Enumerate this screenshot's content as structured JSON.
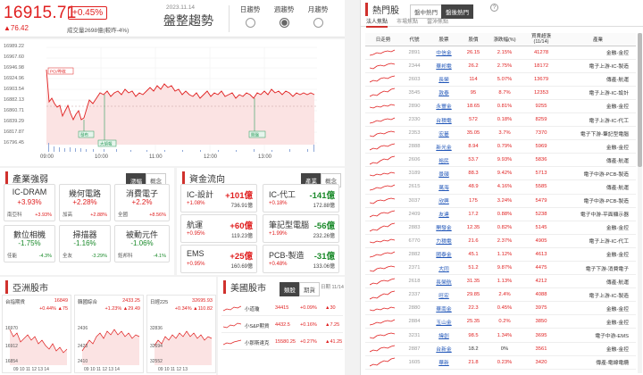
{
  "index": {
    "value": "16915.71",
    "pct": "+0.45%",
    "change": "▲76.42",
    "volume": "成交量2698億(較昨-4%)",
    "date": "2023.11.14",
    "trend": "盤整趨勢"
  },
  "trend_options": [
    {
      "label": "日趨勢",
      "selected": false
    },
    {
      "label": "週趨勢",
      "selected": true
    },
    {
      "label": "月趨勢",
      "selected": false
    }
  ],
  "chart": {
    "y_ticks": [
      "16989.22",
      "16967.60",
      "16946.98",
      "16924.96",
      "16903.54",
      "16882.13",
      "16860.71",
      "16839.29",
      "16817.87",
      "16796.45"
    ],
    "x_ticks": [
      "09:00",
      "10:00",
      "11:00",
      "12:00",
      "13:00"
    ],
    "prev_close_label": "PCI/昨收",
    "markers": [
      "發布",
      "大偵報",
      "開盤"
    ],
    "colors": {
      "line": "#e02020",
      "fill": "#fbe3e3",
      "volume": "#8fa8d8"
    }
  },
  "sectors": {
    "title": "產業強弱",
    "tabs": [
      "漲幅",
      "概念"
    ],
    "cards": [
      {
        "name": "IC-DRAM",
        "pct": "+3.93%",
        "l1": "南亞科",
        "v1": "+3.93%",
        "l2": "",
        "v2": "",
        "dir": "up"
      },
      {
        "name": "幾何電路",
        "pct": "+2.28%",
        "l1": "加高",
        "v1": "+2.88%",
        "l2": "",
        "v2": "",
        "dir": "up"
      },
      {
        "name": "消費電子",
        "pct": "+2.2%",
        "l1": "全國",
        "v1": "+8.56%",
        "l2": "",
        "v2": "",
        "dir": "up"
      },
      {
        "name": "數位相機",
        "pct": "-1.75%",
        "l1": "佳能",
        "v1": "-4.3%",
        "l2": "",
        "v2": "",
        "dir": "dn"
      },
      {
        "name": "掃描器",
        "pct": "-1.16%",
        "l1": "全友",
        "v1": "-3.29%",
        "l2": "",
        "v2": "",
        "dir": "dn"
      },
      {
        "name": "被動元件",
        "pct": "-1.06%",
        "l1": "鈺邦科",
        "v1": "-4.1%",
        "l2": "",
        "v2": "",
        "dir": "dn"
      }
    ]
  },
  "flows": {
    "title": "資金流向",
    "tabs": [
      "產業",
      "概念"
    ],
    "cards": [
      {
        "name": "IC-設計",
        "amt": "+101億",
        "pct": "+1.08%",
        "vol": "736.91億",
        "dir": "up"
      },
      {
        "name": "IC-代工",
        "amt": "-141億",
        "pct": "+0.18%",
        "vol": "172.88億",
        "dir": "dn"
      },
      {
        "name": "航運",
        "amt": "+60億",
        "pct": "+0.95%",
        "vol": "119.23億",
        "dir": "up"
      },
      {
        "name": "筆記型電腦",
        "amt": "-56億",
        "pct": "+1.99%",
        "vol": "232.26億",
        "dir": "dn"
      },
      {
        "name": "EMS",
        "amt": "+25億",
        "pct": "+0.95%",
        "vol": "160.69億",
        "dir": "up"
      },
      {
        "name": "PCB-製造",
        "amt": "-31億",
        "pct": "+0.48%",
        "vol": "133.06億",
        "dir": "dn"
      }
    ]
  },
  "asia": {
    "title": "亞洲股市",
    "charts": [
      {
        "name": "台指期貨",
        "value": "16849",
        "pct": "+0.44%",
        "chg": "▲75",
        "ticks": [
          "16970",
          "16912",
          "16854"
        ],
        "x": "09 10 11 12 13 14"
      },
      {
        "name": "韓國綜合",
        "value": "2433.25",
        "pct": "+1.23%",
        "chg": "▲29.49",
        "ticks": [
          "2436",
          "2423",
          "2410"
        ],
        "x": "09  10  11  12  13  14"
      },
      {
        "name": "日經225",
        "value": "32695.93",
        "pct": "+0.34%",
        "chg": "▲110.82",
        "ticks": [
          "32836",
          "32694",
          "32552"
        ],
        "x": "09  10  11  12  13"
      }
    ]
  },
  "us": {
    "title": "美國股市",
    "tabs": [
      "類股",
      "期貨"
    ],
    "date": "日期 11/14",
    "rows": [
      {
        "name": "小道瓊",
        "value": "34415",
        "pct": "+0.09%",
        "chg": "▲30"
      },
      {
        "name": "小S&P期貨",
        "value": "4432.5",
        "pct": "+0.16%",
        "chg": "▲7.25"
      },
      {
        "name": "小那斯達克",
        "value": "15580.25",
        "pct": "+0.27%",
        "chg": "▲41.25"
      }
    ]
  },
  "hot": {
    "title": "熱門股",
    "tabs": [
      "盤中熱門",
      "盤後熱門"
    ],
    "subtabs": [
      "法人焦點",
      "市場焦點",
      "當沖焦點"
    ],
    "columns": [
      "日走勢",
      "代號",
      "股票",
      "股價",
      "漲跌幅(%)",
      "買賣超張\n(11/14)",
      "產業"
    ],
    "rows": [
      {
        "code": "2891",
        "name": "中信金",
        "price": "26.15",
        "pct": "2.15%",
        "net": "41278",
        "ind": "金融-金控"
      },
      {
        "code": "2344",
        "name": "華邦電",
        "price": "26.2",
        "pct": "2.75%",
        "net": "18172",
        "ind": "電子上游-IC-製造"
      },
      {
        "code": "2603",
        "name": "長榮",
        "price": "114",
        "pct": "5.07%",
        "net": "13679",
        "ind": "傳產-航運"
      },
      {
        "code": "3545",
        "name": "敦泰",
        "price": "95",
        "pct": "8.7%",
        "net": "12353",
        "ind": "電子上游-IC-設計"
      },
      {
        "code": "2890",
        "name": "永豐金",
        "price": "18.65",
        "pct": "0.81%",
        "net": "9255",
        "ind": "金融-金控"
      },
      {
        "code": "2330",
        "name": "台積電",
        "price": "572",
        "pct": "0.18%",
        "net": "8259",
        "ind": "電子上游-IC-代工"
      },
      {
        "code": "2353",
        "name": "宏碁",
        "price": "35.05",
        "pct": "3.7%",
        "net": "7370",
        "ind": "電子下游-筆記型電腦"
      },
      {
        "code": "2888",
        "name": "新光金",
        "price": "8.94",
        "pct": "0.79%",
        "net": "5969",
        "ind": "金融-金控"
      },
      {
        "code": "2606",
        "name": "裕民",
        "price": "53.7",
        "pct": "9.93%",
        "net": "5836",
        "ind": "傳產-航運"
      },
      {
        "code": "3189",
        "name": "景碩",
        "price": "88.3",
        "pct": "9.42%",
        "net": "5713",
        "ind": "電子中游-PCB-製造"
      },
      {
        "code": "2615",
        "name": "萬海",
        "price": "48.9",
        "pct": "4.16%",
        "net": "5585",
        "ind": "傳產-航運"
      },
      {
        "code": "3037",
        "name": "欣興",
        "price": "175",
        "pct": "3.24%",
        "net": "5479",
        "ind": "電子中游-PCB-製造"
      },
      {
        "code": "2409",
        "name": "友達",
        "price": "17.2",
        "pct": "0.88%",
        "net": "5238",
        "ind": "電子中游-平面顯示器"
      },
      {
        "code": "2883",
        "name": "開發金",
        "price": "12.35",
        "pct": "0.82%",
        "net": "5145",
        "ind": "金融-金控"
      },
      {
        "code": "6770",
        "name": "力積電",
        "price": "21.6",
        "pct": "2.37%",
        "net": "4905",
        "ind": "電子上游-IC-代工"
      },
      {
        "code": "2882",
        "name": "國泰金",
        "price": "45.1",
        "pct": "1.12%",
        "net": "4613",
        "ind": "金融-金控"
      },
      {
        "code": "2371",
        "name": "大同",
        "price": "51.2",
        "pct": "9.87%",
        "net": "4475",
        "ind": "電子下游-消費電子"
      },
      {
        "code": "2618",
        "name": "長榮航",
        "price": "31.35",
        "pct": "1.13%",
        "net": "4212",
        "ind": "傳產-航運"
      },
      {
        "code": "2337",
        "name": "旺宏",
        "price": "29.85",
        "pct": "2.4%",
        "net": "4088",
        "ind": "電子上游-IC-製造"
      },
      {
        "code": "2880",
        "name": "華南金",
        "price": "22.3",
        "pct": "0.45%",
        "net": "3975",
        "ind": "金融-金控"
      },
      {
        "code": "2884",
        "name": "玉山金",
        "price": "25.35",
        "pct": "0.2%",
        "net": "3850",
        "ind": "金融-金控"
      },
      {
        "code": "3231",
        "name": "緯創",
        "price": "98.5",
        "pct": "1.34%",
        "net": "3695",
        "ind": "電子中游-EMS"
      },
      {
        "code": "2887",
        "name": "台新金",
        "price": "18.2",
        "pct": "0%",
        "net": "3561",
        "ind": "金融-金控"
      },
      {
        "code": "1605",
        "name": "華新",
        "price": "21.8",
        "pct": "0.23%",
        "net": "3420",
        "ind": "傳產-電線電纜"
      }
    ]
  }
}
